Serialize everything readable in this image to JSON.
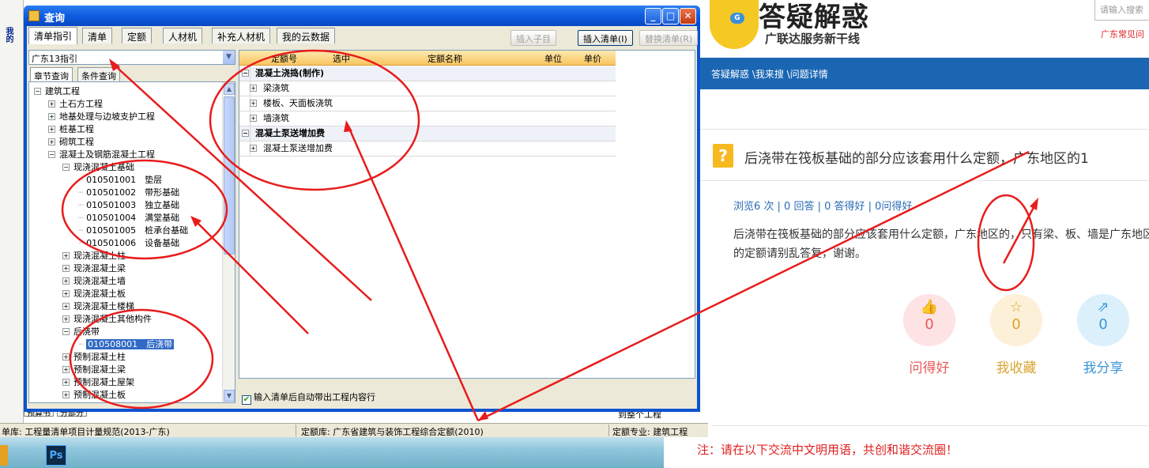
{
  "dialog": {
    "title": "查询",
    "tabs": [
      "清单指引",
      "清单",
      "定额",
      "人材机",
      "补充人材机",
      "我的云数据"
    ],
    "buttons": {
      "insert_child": "插入子目",
      "insert_list": "插入清单(I)",
      "replace_list": "替换清单(R)"
    },
    "library_select": "广东13指引",
    "subtabs": [
      "章节查询",
      "条件查询"
    ],
    "tree": [
      {
        "label": "建筑工程",
        "level": 0,
        "state": "minus"
      },
      {
        "label": "土石方工程",
        "level": 1,
        "state": "plus"
      },
      {
        "label": "地基处理与边坡支护工程",
        "level": 1,
        "state": "plus"
      },
      {
        "label": "桩基工程",
        "level": 1,
        "state": "plus"
      },
      {
        "label": "砌筑工程",
        "level": 1,
        "state": "plus"
      },
      {
        "label": "混凝土及钢筋混凝土工程",
        "level": 1,
        "state": "minus"
      },
      {
        "label": "现浇混凝土基础",
        "level": 2,
        "state": "minus"
      },
      {
        "label": "010501001　垫层",
        "level": 3,
        "state": "leaf"
      },
      {
        "label": "010501002　带形基础",
        "level": 3,
        "state": "leaf"
      },
      {
        "label": "010501003　独立基础",
        "level": 3,
        "state": "leaf"
      },
      {
        "label": "010501004　满堂基础",
        "level": 3,
        "state": "leaf"
      },
      {
        "label": "010501005　桩承台基础",
        "level": 3,
        "state": "leaf"
      },
      {
        "label": "010501006　设备基础",
        "level": 3,
        "state": "leaf"
      },
      {
        "label": "现浇混凝土柱",
        "level": 2,
        "state": "plus"
      },
      {
        "label": "现浇混凝土梁",
        "level": 2,
        "state": "plus"
      },
      {
        "label": "现浇混凝土墙",
        "level": 2,
        "state": "plus"
      },
      {
        "label": "现浇混凝土板",
        "level": 2,
        "state": "plus"
      },
      {
        "label": "现浇混凝土楼梯",
        "level": 2,
        "state": "plus"
      },
      {
        "label": "现浇混凝土其他构件",
        "level": 2,
        "state": "plus"
      },
      {
        "label": "后浇带",
        "level": 2,
        "state": "minus"
      },
      {
        "label": "010508001　后浇带",
        "level": 3,
        "state": "leaf",
        "selected": true
      },
      {
        "label": "预制混凝土柱",
        "level": 2,
        "state": "plus"
      },
      {
        "label": "预制混凝土梁",
        "level": 2,
        "state": "plus"
      },
      {
        "label": "预制混凝土屋架",
        "level": 2,
        "state": "plus"
      },
      {
        "label": "预制混凝土板",
        "level": 2,
        "state": "plus"
      }
    ],
    "grid_headers": [
      "定额号",
      "选中",
      "定额名称",
      "单位",
      "单价"
    ],
    "grid_rows": [
      {
        "label": "混凝土浇捣(制作)",
        "group": true
      },
      {
        "label": "梁浇筑",
        "group": false
      },
      {
        "label": "楼板、天面板浇筑",
        "group": false
      },
      {
        "label": "墙浇筑",
        "group": false
      },
      {
        "label": "混凝土泵送增加费",
        "group": true
      },
      {
        "label": "混凝土泵送增加费",
        "group": false
      }
    ],
    "autofill_label": "输入清单后自动带出工程内容行"
  },
  "host": {
    "sidebar_top": "我的",
    "tab_a": "预算书",
    "tab_b": "分部分",
    "whole_project": "到整个工程"
  },
  "status_bar": {
    "list_lib": "单库: 工程量清单项目计量规范(2013-广东)",
    "quota_lib": "定额库: 广东省建筑与装饰工程综合定额(2010)",
    "quota_major": "定额专业: 建筑工程"
  },
  "web": {
    "site_title": "答疑解惑",
    "site_sub": "广联达服务新干线",
    "search_placeholder": "请输入搜索",
    "top_link": "广东常见问",
    "breadcrumb": "答疑解惑 \\我来搜 \\问题详情",
    "question_title": "后浇带在筏板基础的部分应该套用什么定额，广东地区的1",
    "stats": "浏览6 次 | 0 回答 | 0 答得好 | 0问得好",
    "question_body": "后浇带在筏板基础的部分应该套用什么定额，广东地区的，只有梁、板、墙是广东地区的定额请别乱答复，谢谢。",
    "actions": [
      {
        "label": "问得好",
        "count": "0",
        "icon": "thumbs-up-icon",
        "color": "#e85a5a",
        "bg": "#fde3e3"
      },
      {
        "label": "我收藏",
        "count": "0",
        "icon": "star-icon",
        "color": "#d9a430",
        "bg": "#fdf0d8"
      },
      {
        "label": "我分享",
        "count": "0",
        "icon": "share-icon",
        "color": "#3a96d6",
        "bg": "#dcf0fb"
      }
    ],
    "notice": "注：请在以下交流中文明用语，共创和谐交流圈！"
  },
  "desktop": {
    "ps_label": "Ps"
  }
}
